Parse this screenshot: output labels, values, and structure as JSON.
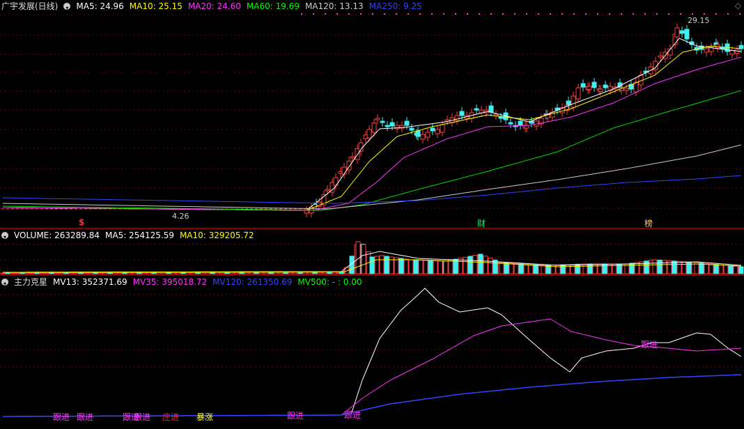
{
  "main_header": {
    "title": "广宇发展(日线)",
    "ma5": "MA5: 24.96",
    "ma10": "MA10: 25.15",
    "ma20": "MA20: 24.60",
    "ma60": "MA60: 19.69",
    "ma120": "MA120: 13.13",
    "ma250": "MA250: 9.25",
    "colors": {
      "ma5": "#ffffff",
      "ma10": "#ffff00",
      "ma20": "#ff33ff",
      "ma60": "#00ff00",
      "ma120": "#cccccc",
      "ma250": "#3344ff"
    }
  },
  "main_annotations": {
    "high_label": "29.15",
    "low_label": "4.26",
    "marker_s": "$",
    "marker_cai": "财",
    "marker_bang": "榜"
  },
  "volume_header": {
    "volume": "VOLUME: 263289.84",
    "ma5": "MA5: 254125.59",
    "ma10": "MA10: 329205.72"
  },
  "indicator_header": {
    "title": "主力克星",
    "mv13": "MV13: 352371.69",
    "mv35": "MV35: 395018.72",
    "mv120": "MV120: 261350.69",
    "mv500": "MV500: - : 0.00"
  },
  "indicator_labels": {
    "gen_jin": "跟进",
    "zhuang_jin": "庄进",
    "bao_zhang": "暴涨"
  },
  "chart_data": [
    {
      "type": "line",
      "title": "广宇发展(日线)",
      "note": "candlestick price chart with moving averages",
      "y_annotations": {
        "high": 29.15,
        "low": 4.26
      },
      "series": [
        {
          "name": "MA5",
          "last": 24.96
        },
        {
          "name": "MA10",
          "last": 25.15
        },
        {
          "name": "MA20",
          "last": 24.6
        },
        {
          "name": "MA60",
          "last": 19.69
        },
        {
          "name": "MA120",
          "last": 13.13
        },
        {
          "name": "MA250",
          "last": 9.25
        }
      ]
    },
    {
      "type": "bar",
      "title": "VOLUME",
      "series": [
        {
          "name": "VOLUME",
          "last": 263289.84
        },
        {
          "name": "MA5",
          "last": 254125.59
        },
        {
          "name": "MA10",
          "last": 329205.72
        }
      ]
    },
    {
      "type": "line",
      "title": "主力克星",
      "series": [
        {
          "name": "MV13",
          "last": 352371.69
        },
        {
          "name": "MV35",
          "last": 395018.72
        },
        {
          "name": "MV120",
          "last": 261350.69
        }
      ]
    }
  ]
}
